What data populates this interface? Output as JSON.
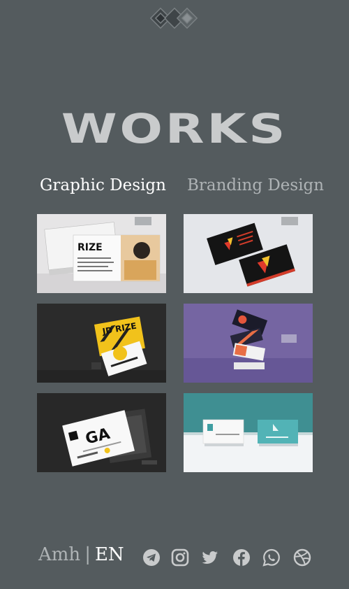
{
  "page": {
    "title": "WORKS"
  },
  "tabs": [
    {
      "label": "Graphic Design",
      "active": true
    },
    {
      "label": "Branding Design",
      "active": false
    }
  ],
  "works": [
    {
      "id": "work-1",
      "icon": "business-card-rize-mockup"
    },
    {
      "id": "work-2",
      "icon": "black-red-card-mockup"
    },
    {
      "id": "work-3",
      "icon": "yellow-jd-rize-card-mockup"
    },
    {
      "id": "work-4",
      "icon": "floating-cards-purple-mockup"
    },
    {
      "id": "work-5",
      "icon": "ga-card-dark-mockup"
    },
    {
      "id": "work-6",
      "icon": "teal-white-card-mockup"
    }
  ],
  "language": {
    "amh": "Amh",
    "separator": "|",
    "en": "EN"
  },
  "social": [
    "telegram-icon",
    "instagram-icon",
    "twitter-icon",
    "facebook-icon",
    "whatsapp-icon",
    "dribbble-icon"
  ],
  "colors": {
    "background": "#545b5e",
    "title": "#c9cbcc",
    "active_tab": "#ffffff",
    "inactive_tab": "#aeb3b5"
  }
}
